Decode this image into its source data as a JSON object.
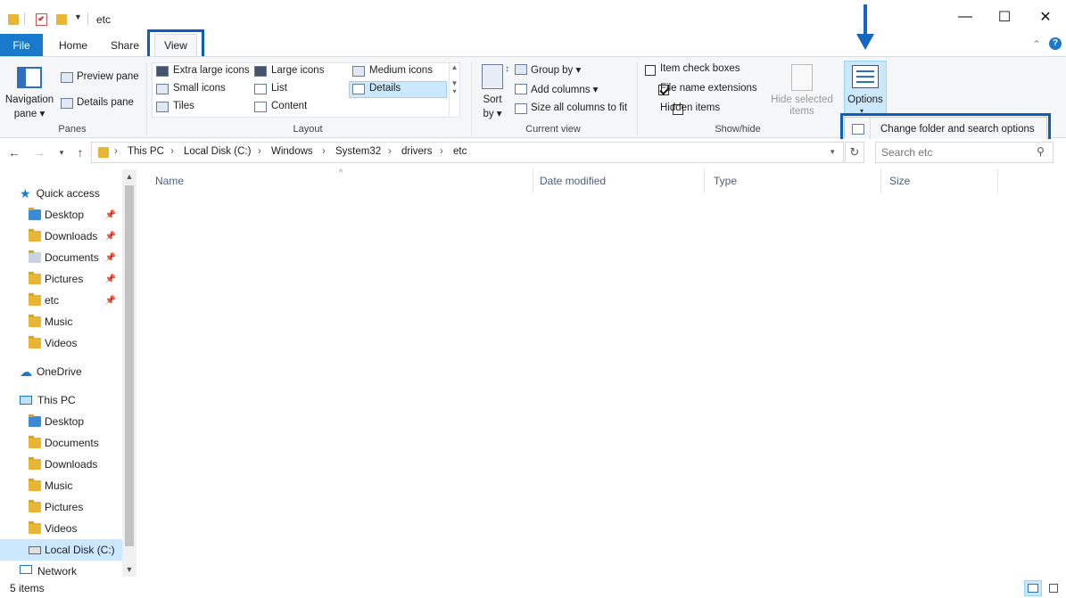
{
  "window": {
    "title": "etc",
    "minimize_glyph": "—",
    "maximize_glyph": "☐",
    "close_glyph": "✕"
  },
  "tabs": {
    "file": "File",
    "home": "Home",
    "share": "Share",
    "view": "View"
  },
  "ribbon": {
    "panes": {
      "navigation_pane": "Navigation",
      "navigation_pane_2": "pane",
      "preview_pane": "Preview pane",
      "details_pane": "Details pane",
      "label": "Panes"
    },
    "layout": {
      "extra_large_icons": "Extra large icons",
      "large_icons": "Large icons",
      "medium_icons": "Medium icons",
      "small_icons": "Small icons",
      "list": "List",
      "details": "Details",
      "tiles": "Tiles",
      "content": "Content",
      "label": "Layout"
    },
    "current_view": {
      "sort_by": "Sort",
      "sort_by_2": "by",
      "group_by": "Group by",
      "add_columns": "Add columns",
      "size_all_columns": "Size all columns to fit",
      "label": "Current view"
    },
    "show_hide": {
      "item_check_boxes": "Item check boxes",
      "file_name_extensions": "File name extensions",
      "hidden_items": "Hidden items",
      "hide_selected_items": "Hide selected",
      "hide_selected_items_2": "items",
      "label": "Show/hide",
      "item_check_boxes_checked": false,
      "file_name_extensions_checked": true,
      "hidden_items_checked": false
    },
    "options": {
      "label": "Options",
      "dropdown_item": "Change folder and search options"
    }
  },
  "address": {
    "crumbs": [
      "This PC",
      "Local Disk (C:)",
      "Windows",
      "System32",
      "drivers",
      "etc"
    ],
    "search_placeholder": "Search etc"
  },
  "sidebar": {
    "quick_access": "Quick access",
    "quick_items": [
      {
        "label": "Desktop",
        "icon": "desktop-icon",
        "pinned": true
      },
      {
        "label": "Downloads",
        "icon": "downloads-icon",
        "pinned": true
      },
      {
        "label": "Documents",
        "icon": "documents-icon",
        "pinned": true
      },
      {
        "label": "Pictures",
        "icon": "pictures-icon",
        "pinned": true
      },
      {
        "label": "etc",
        "icon": "folder-icon",
        "pinned": true
      },
      {
        "label": "Music",
        "icon": "music-icon",
        "pinned": false
      },
      {
        "label": "Videos",
        "icon": "videos-icon",
        "pinned": false
      }
    ],
    "onedrive": "OneDrive",
    "this_pc": "This PC",
    "pc_items": [
      {
        "label": "Desktop",
        "icon": "desktop-icon"
      },
      {
        "label": "Documents",
        "icon": "documents-icon"
      },
      {
        "label": "Downloads",
        "icon": "downloads-icon"
      },
      {
        "label": "Music",
        "icon": "music-icon"
      },
      {
        "label": "Pictures",
        "icon": "pictures-icon"
      },
      {
        "label": "Videos",
        "icon": "videos-icon"
      },
      {
        "label": "Local Disk (C:)",
        "icon": "local-disk-icon"
      }
    ],
    "network_partial": "Network"
  },
  "columns": {
    "name": "Name",
    "date_modified": "Date modified",
    "type": "Type",
    "size": "Size"
  },
  "status": {
    "item_count": "5 items"
  },
  "colors": {
    "accent": "#1979ca",
    "highlight_box": "#0b5ebd",
    "selected_bg": "#cce8ff"
  }
}
